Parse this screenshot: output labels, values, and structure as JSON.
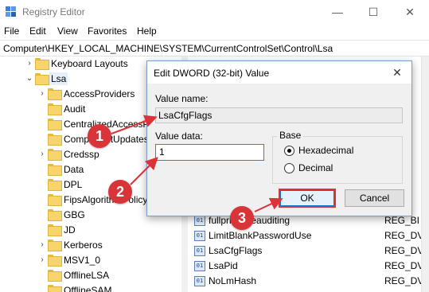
{
  "window": {
    "title": "Registry Editor",
    "controls": {
      "minimize": "—",
      "maximize": "☐",
      "close": "✕"
    }
  },
  "menu": {
    "items": [
      "File",
      "Edit",
      "View",
      "Favorites",
      "Help"
    ]
  },
  "address": {
    "path": "Computer\\HKEY_LOCAL_MACHINE\\SYSTEM\\CurrentControlSet\\Control\\Lsa"
  },
  "tree": {
    "items": [
      {
        "label": "Keyboard Layouts",
        "chevron": "›"
      },
      {
        "label": "Lsa",
        "chevron": "⌄"
      },
      {
        "label": "AccessProviders",
        "chevron": "›"
      },
      {
        "label": "Audit",
        "chevron": ""
      },
      {
        "label": "CentralizedAccessP",
        "chevron": ""
      },
      {
        "label": "ComponentUpdates",
        "chevron": ""
      },
      {
        "label": "Credssp",
        "chevron": "›"
      },
      {
        "label": "Data",
        "chevron": ""
      },
      {
        "label": "DPL",
        "chevron": ""
      },
      {
        "label": "FipsAlgorithmPolicy",
        "chevron": ""
      },
      {
        "label": "GBG",
        "chevron": ""
      },
      {
        "label": "JD",
        "chevron": ""
      },
      {
        "label": "Kerberos",
        "chevron": "›"
      },
      {
        "label": "MSV1_0",
        "chevron": "›"
      },
      {
        "label": "OfflineLSA",
        "chevron": ""
      },
      {
        "label": "OfflineSAM",
        "chevron": ""
      }
    ]
  },
  "list": {
    "rows": [
      {
        "name": "fullprivilegeauditing",
        "type": "REG_BI",
        "icon": "01"
      },
      {
        "name": "LimitBlankPasswordUse",
        "type": "REG_DV",
        "icon": "01"
      },
      {
        "name": "LsaCfgFlags",
        "type": "REG_DV",
        "icon": "01"
      },
      {
        "name": "LsaPid",
        "type": "REG_DV",
        "icon": "01"
      },
      {
        "name": "NoLmHash",
        "type": "REG_DV",
        "icon": "01"
      }
    ]
  },
  "dialog": {
    "title": "Edit DWORD (32-bit) Value",
    "close": "✕",
    "value_name_label": "Value name:",
    "value_name": "LsaCfgFlags",
    "value_data_label": "Value data:",
    "value_data": "1",
    "base_label": "Base",
    "base_options": [
      "Hexadecimal",
      "Decimal"
    ],
    "base_selected": "Hexadecimal",
    "ok_label": "OK",
    "cancel_label": "Cancel"
  },
  "annotations": {
    "markers": [
      "1",
      "2",
      "3"
    ],
    "color": "#d93438"
  },
  "colors": {
    "accent": "#0078d7",
    "folder": "#f8d56a",
    "selection": "#e5f0fb"
  }
}
